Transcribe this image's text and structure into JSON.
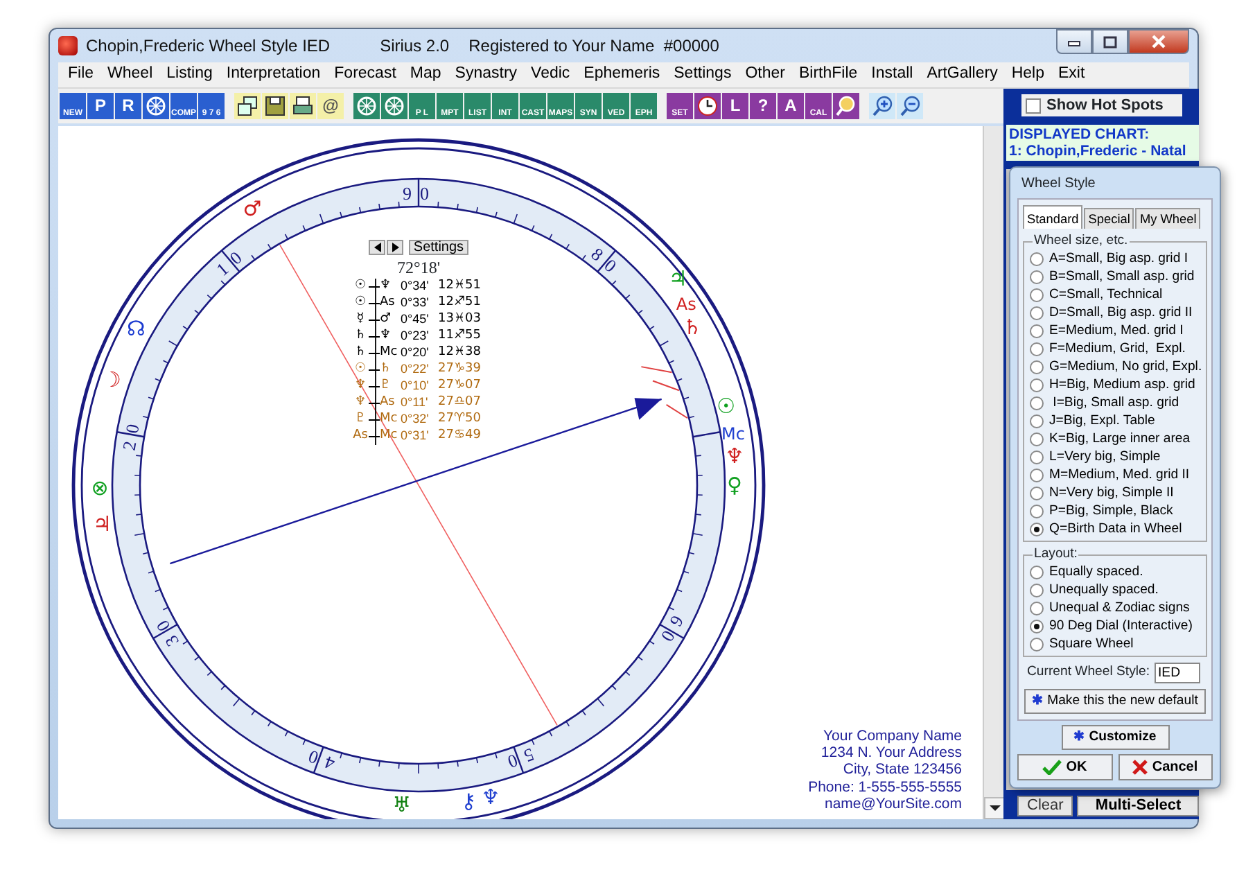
{
  "window": {
    "title": "Chopin,Frederic Wheel Style IED",
    "product": "Sirius 2.0",
    "registration": "Registered to Your Name  #00000"
  },
  "menu": [
    "File",
    "Wheel",
    "Listing",
    "Interpretation",
    "Forecast",
    "Map",
    "Synastry",
    "Vedic",
    "Ephemeris",
    "Settings",
    "Other",
    "BirthFile",
    "Install",
    "ArtGallery",
    "Help",
    "Exit"
  ],
  "toolbar": [
    [
      {
        "kind": "text",
        "label": "NEW"
      },
      {
        "kind": "text",
        "label": "P"
      },
      {
        "kind": "text",
        "label": "R"
      },
      {
        "kind": "ring"
      },
      {
        "kind": "text",
        "label": "COMP"
      },
      {
        "kind": "text",
        "label": "9 7 6"
      }
    ],
    [
      {
        "kind": "windows"
      },
      {
        "kind": "disk"
      },
      {
        "kind": "printer"
      },
      {
        "kind": "text",
        "label": "@"
      }
    ],
    [
      {
        "kind": "ring"
      },
      {
        "kind": "ring"
      },
      {
        "kind": "text",
        "label": "P L"
      },
      {
        "kind": "text",
        "label": "MPT"
      },
      {
        "kind": "text",
        "label": "LIST"
      },
      {
        "kind": "text",
        "label": "INT"
      },
      {
        "kind": "text",
        "label": "CAST"
      },
      {
        "kind": "text",
        "label": "MAPS"
      },
      {
        "kind": "text",
        "label": "SYN"
      },
      {
        "kind": "text",
        "label": "VED"
      },
      {
        "kind": "text",
        "label": "EPH"
      }
    ],
    [
      {
        "kind": "text",
        "label": "SET"
      },
      {
        "kind": "clock"
      },
      {
        "kind": "text",
        "label": "L"
      },
      {
        "kind": "text",
        "label": "?"
      },
      {
        "kind": "text",
        "label": "A"
      },
      {
        "kind": "text",
        "label": "CAL"
      },
      {
        "kind": "magnifier"
      }
    ],
    [
      {
        "kind": "zoom-in"
      },
      {
        "kind": "zoom-out"
      }
    ]
  ],
  "hot_spots": {
    "label": "Show Hot Spots",
    "checked": false
  },
  "displayed_chart": {
    "heading": "DISPLAYED CHART:",
    "name": "1: Chopin,Frederic - Natal"
  },
  "chart_buttons": [
    "Clear",
    "Multi-Select"
  ],
  "wheel": {
    "dial_labels": [
      "90",
      "10",
      "20",
      "30",
      "40",
      "50",
      "60",
      "80"
    ],
    "glyphs": [
      {
        "glyph": "♂",
        "color": "#d02020"
      },
      {
        "glyph": "☊",
        "color": "#1a3ad0"
      },
      {
        "glyph": "☽",
        "color": "#d02020"
      },
      {
        "glyph": "⊗",
        "color": "#10a020"
      },
      {
        "glyph": "♃",
        "color": "#d02020"
      },
      {
        "glyph": "♅",
        "color": "#108010"
      },
      {
        "glyph": "⚷",
        "color": "#2040d0"
      },
      {
        "glyph": "♆",
        "color": "#2040d0"
      },
      {
        "glyph": "♃",
        "color": "#10a020"
      },
      {
        "glyph": "As",
        "color": "#d02020"
      },
      {
        "glyph": "♄",
        "color": "#d02020"
      },
      {
        "glyph": "☉",
        "color": "#10a020"
      },
      {
        "glyph": "Mc",
        "color": "#2040d0"
      },
      {
        "glyph": "♆",
        "color": "#d02020"
      },
      {
        "glyph": "♀",
        "color": "#10a020"
      }
    ],
    "settings_label": "Settings",
    "reading": "72°18'",
    "aspects": [
      {
        "p1": "☉",
        "p2": "♆",
        "orb": "0°34'",
        "position": "12♓51",
        "color": "#000000"
      },
      {
        "p1": "☉",
        "p2": "As",
        "orb": "0°33'",
        "position": "12♐51",
        "color": "#000000"
      },
      {
        "p1": "☿",
        "p2": "♂",
        "orb": "0°45'",
        "position": "13♓03",
        "color": "#000000"
      },
      {
        "p1": "♄",
        "p2": "♆",
        "orb": "0°23'",
        "position": "11♐55",
        "color": "#000000"
      },
      {
        "p1": "♄",
        "p2": "Mc",
        "orb": "0°20'",
        "position": "12♓38",
        "color": "#000000"
      },
      {
        "p1": "☉",
        "p2": "♄",
        "orb": "0°22'",
        "position": "27♑39",
        "color": "#b06a10"
      },
      {
        "p1": "♆",
        "p2": "♇",
        "orb": "0°10'",
        "position": "27♑07",
        "color": "#b06a10"
      },
      {
        "p1": "♆",
        "p2": "As",
        "orb": "0°11'",
        "position": "27♎07",
        "color": "#b06a10"
      },
      {
        "p1": "♇",
        "p2": "Mc",
        "orb": "0°32'",
        "position": "27♈50",
        "color": "#b06a10"
      },
      {
        "p1": "As",
        "p2": "Mc",
        "orb": "0°31'",
        "position": "27♋49",
        "color": "#b06a10"
      }
    ]
  },
  "company": [
    "Your Company Name",
    "1234 N. Your Address",
    "City, State 123456",
    "Phone: 1-555-555-5555",
    "name@YourSite.com"
  ],
  "dialog": {
    "title": "Wheel Style",
    "tabs": [
      {
        "label": "Standard",
        "selected": true
      },
      {
        "label": "Special",
        "selected": false
      },
      {
        "label": "My Wheel",
        "selected": false
      }
    ],
    "size_group": {
      "legend": "Wheel size, etc.",
      "options": [
        {
          "label": "A=Small, Big asp. grid I",
          "selected": false
        },
        {
          "label": "B=Small, Small asp. grid",
          "selected": false
        },
        {
          "label": "C=Small, Technical",
          "selected": false
        },
        {
          "label": "D=Small, Big asp. grid II",
          "selected": false
        },
        {
          "label": "E=Medium, Med. grid I",
          "selected": false
        },
        {
          "label": "F=Medium, Grid,  Expl.",
          "selected": false
        },
        {
          "label": "G=Medium, No grid, Expl.",
          "selected": false
        },
        {
          "label": "H=Big, Medium asp. grid",
          "selected": false
        },
        {
          "label": " I=Big, Small asp. grid",
          "selected": false
        },
        {
          "label": "J=Big, Expl. Table",
          "selected": false
        },
        {
          "label": "K=Big, Large inner area",
          "selected": false
        },
        {
          "label": "L=Very big, Simple",
          "selected": false
        },
        {
          "label": "M=Medium, Med. grid II",
          "selected": false
        },
        {
          "label": "N=Very big, Simple II",
          "selected": false
        },
        {
          "label": "P=Big, Simple, Black",
          "selected": false
        },
        {
          "label": "Q=Birth Data in Wheel",
          "selected": true
        }
      ]
    },
    "layout_group": {
      "legend": "Layout:",
      "options": [
        {
          "label": "Equally spaced.",
          "selected": false
        },
        {
          "label": "Unequally spaced.",
          "selected": false
        },
        {
          "label": "Unequal & Zodiac signs",
          "selected": false
        },
        {
          "label": "90 Deg Dial (Interactive)",
          "selected": true
        },
        {
          "label": "Square Wheel",
          "selected": false
        }
      ]
    },
    "current_style": {
      "label": "Current Wheel Style:",
      "value": "IED"
    },
    "default_button": {
      "icon": "✱",
      "label": "Make this the new default"
    },
    "customize_button": {
      "icon": "✱",
      "label": "Customize"
    },
    "ok_button": "OK",
    "cancel_button": "Cancel"
  }
}
